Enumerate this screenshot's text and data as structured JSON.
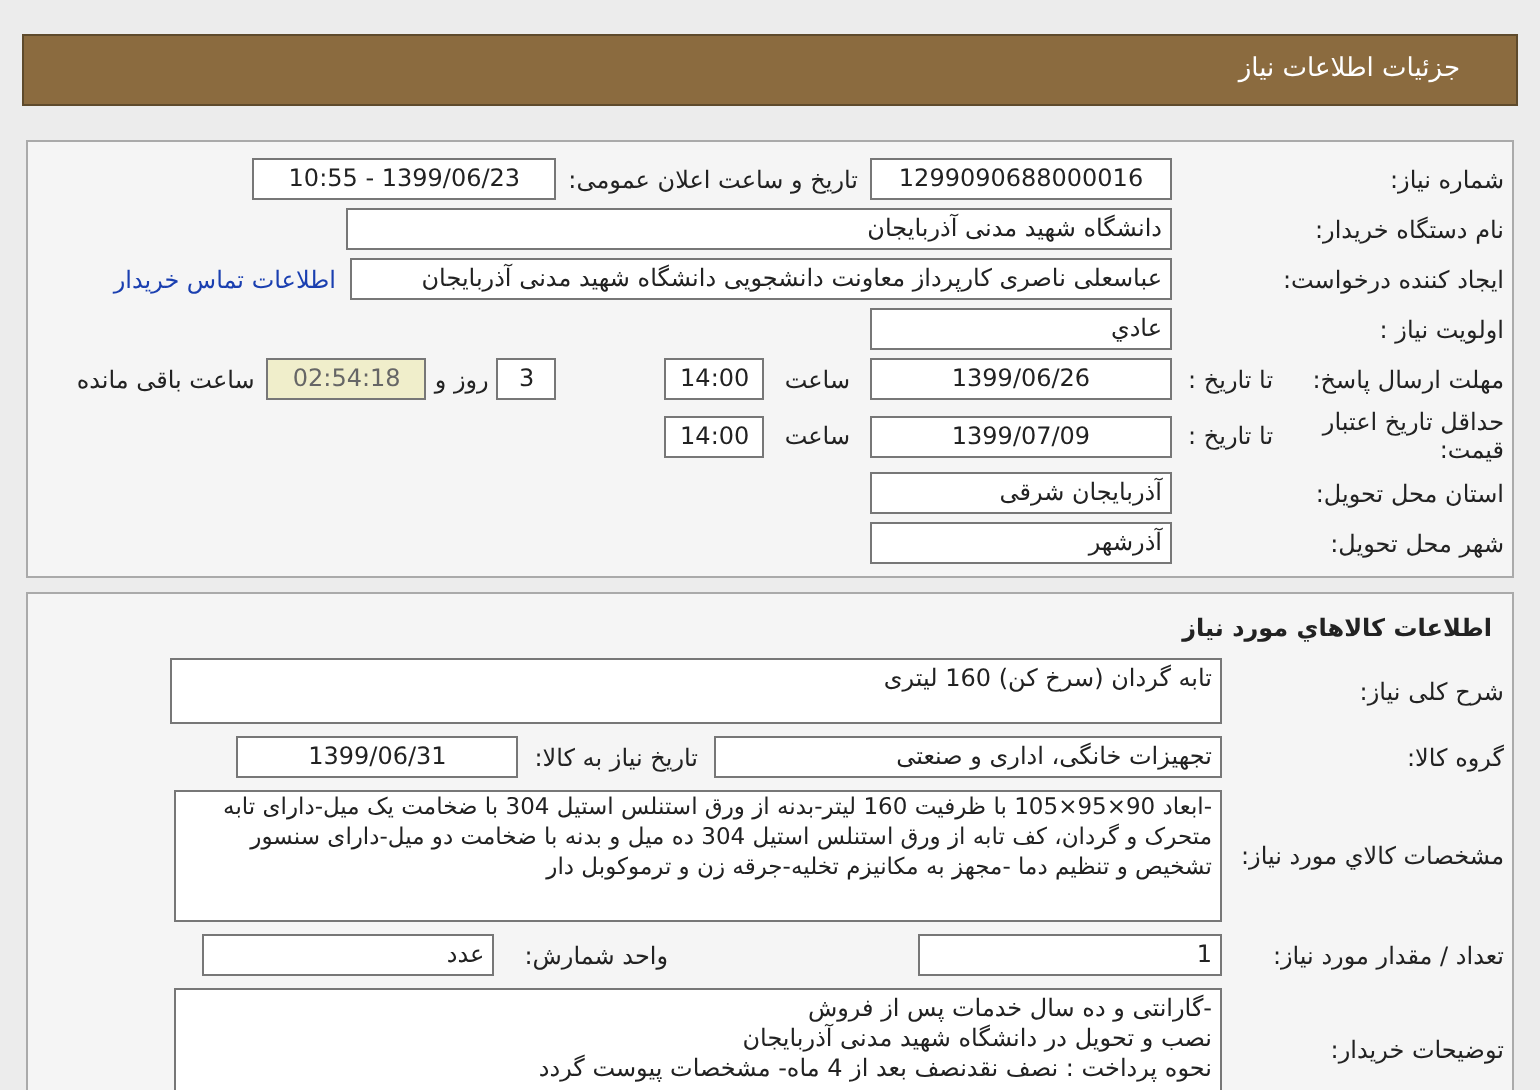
{
  "header": {
    "title": "جزئیات اطلاعات نیاز"
  },
  "details": {
    "need_number": {
      "label": "شماره نیاز:",
      "value": "1299090688000016"
    },
    "announce": {
      "label": "تاریخ و ساعت اعلان عمومی:",
      "value": "1399/06/23 - 10:55"
    },
    "buyer": {
      "label": "نام دستگاه خریدار:",
      "value": "دانشگاه شهید مدنی آذربایجان"
    },
    "requester": {
      "label": "ایجاد کننده درخواست:",
      "value": "عباسعلی ناصری کارپرداز معاونت دانشجویی دانشگاه شهید مدنی آذربایجان",
      "link": "اطلاعات تماس خریدار"
    },
    "priority": {
      "label": "اولویت نیاز :",
      "value": "عادي"
    },
    "deadline": {
      "label": "مهلت ارسال پاسخ:",
      "to_label": "تا تاریخ :",
      "date": "1399/06/26",
      "time_label": "ساعت",
      "time": "14:00",
      "days": "3",
      "days_label": "روز و",
      "remaining": "02:54:18",
      "remaining_label": "ساعت باقی مانده"
    },
    "validity": {
      "label": "حداقل تاریخ اعتبار قیمت:",
      "to_label": "تا تاریخ :",
      "date": "1399/07/09",
      "time_label": "ساعت",
      "time": "14:00"
    },
    "province": {
      "label": "استان محل تحویل:",
      "value": "آذربایجان شرقی"
    },
    "city": {
      "label": "شهر محل تحویل:",
      "value": "آذرشهر"
    }
  },
  "goods": {
    "title": "اطلاعات کالاهاي مورد نیاز",
    "description": {
      "label": "شرح کلی نیاز:",
      "value": "تابه گردان (سرخ کن) 160 لیتری"
    },
    "group": {
      "label": "گروه کالا:",
      "value": "تجهیزات خانگی، اداری و صنعتی",
      "date_label": "تاریخ نیاز به کالا:",
      "date": "1399/06/31"
    },
    "specs": {
      "label": "مشخصات کالاي مورد نیاز:",
      "value": "-ابعاد 90×95×105 با ظرفیت 160 لیتر-بدنه از ورق استنلس استیل 304 با ضخامت یک میل-دارای تابه متحرک و گردان، کف تابه از ورق استنلس استیل 304 ده میل و بدنه با ضخامت دو میل-دارای سنسور تشخیص و تنظیم دما -مجهز به مکانیزم تخلیه-جرقه زن و ترموکوبل دار"
    },
    "quantity": {
      "label": "تعداد / مقدار مورد نیاز:",
      "value": "1",
      "unit_label": "واحد شمارش:",
      "unit": "عدد"
    },
    "notes": {
      "label": "توضیحات خریدار:",
      "lines": [
        "-گارانتی و ده سال خدمات پس از فروش",
        "نصب و تحویل در دانشگاه شهید مدنی آذربایجان",
        "نحوه پرداخت : نصف نقدنصف بعد از 4 ماه- مشخصات پیوست گردد"
      ]
    }
  }
}
